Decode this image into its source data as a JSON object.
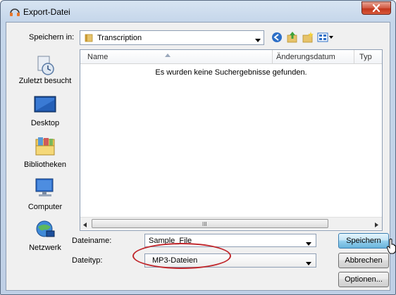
{
  "window": {
    "title": "Export-Datei",
    "close_symbol": "x",
    "icons": [
      "headphones-icon",
      "close-icon"
    ]
  },
  "save_in": {
    "label": "Speichern in:",
    "value": "Transcription",
    "toolbar_icons": [
      "back-icon",
      "up-folder-icon",
      "new-folder-icon",
      "view-menu-icon"
    ]
  },
  "places": [
    {
      "label": "Zuletzt besucht",
      "icon": "recent-places-icon"
    },
    {
      "label": "Desktop",
      "icon": "desktop-icon"
    },
    {
      "label": "Bibliotheken",
      "icon": "libraries-icon"
    },
    {
      "label": "Computer",
      "icon": "computer-icon"
    },
    {
      "label": "Netzwerk",
      "icon": "network-icon"
    }
  ],
  "file_list": {
    "columns": [
      "Name",
      "Änderungsdatum",
      "Typ"
    ],
    "empty_message": "Es wurden keine Suchergebnisse gefunden.",
    "scroll_grip": "III"
  },
  "form": {
    "filename_label": "Dateiname:",
    "filename_value": "Sample_File",
    "filetype_label": "Dateityp:",
    "filetype_value": "MP3-Dateien"
  },
  "buttons": {
    "save": "Speichern",
    "cancel": "Abbrechen",
    "options": "Optionen..."
  },
  "colors": {
    "highlight_ellipse": "#c0262b",
    "close_button": "#c2361c",
    "default_button_border": "#3c7fb1"
  }
}
